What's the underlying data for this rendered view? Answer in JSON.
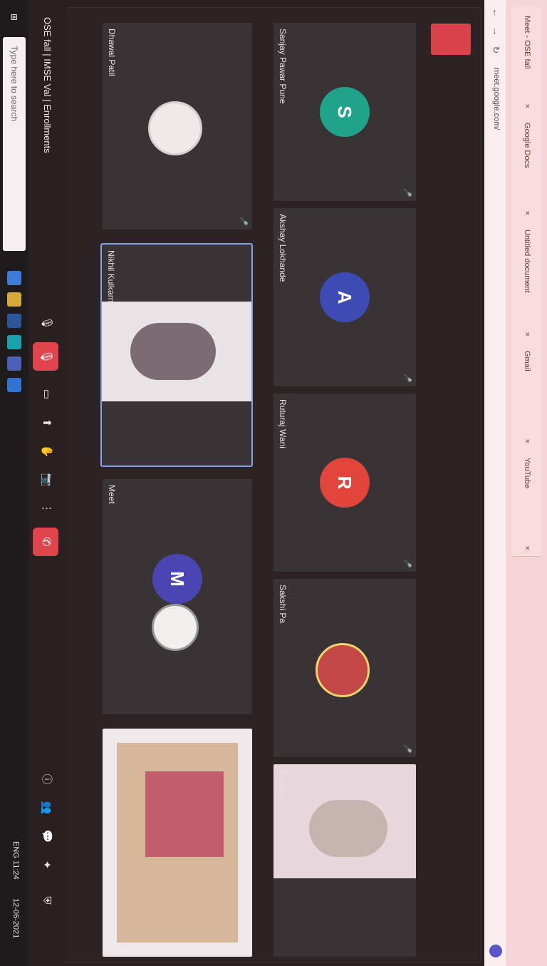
{
  "browser": {
    "tabs": [
      {
        "label": "Meet - OSE fall",
        "close": "×"
      },
      {
        "label": "Google Docs",
        "close": "×"
      },
      {
        "label": "Untitled document",
        "close": "×"
      },
      {
        "label": "Gmail",
        "close": "×"
      },
      {
        "label": "YouTube",
        "close": "×"
      }
    ],
    "url": "meet.google.com/",
    "nav_icons": [
      "back-arrow-icon",
      "forward-arrow-icon",
      "reload-icon"
    ],
    "nav_glyphs": [
      "←",
      "→",
      "↻"
    ]
  },
  "meeting": {
    "tiles": [
      {
        "name": "Sanjay Pawar Pune",
        "initial": "S",
        "color": "#1fa38a"
      },
      {
        "name": "Akshay Lokhande",
        "initial": "A",
        "color": "#3f4bb5"
      },
      {
        "name": "Ruturaj Wani",
        "initial": "R",
        "color": "#e0443b"
      },
      {
        "name": "Sakshi Pa",
        "initial": "",
        "color": "#c34747"
      },
      {
        "name": "Vaishali",
        "initial": "",
        "color": "#dcdbe8"
      },
      {
        "name": "Dhawal Patil",
        "initial": "",
        "color": "#efe9ea"
      },
      {
        "name": "Nikhil Kulkarni",
        "initial": "",
        "color": "#9b8f96"
      },
      {
        "name": "Meet",
        "initial": "M",
        "color": "#4a45b2"
      },
      {
        "name": "",
        "initial": "",
        "color": "#8a5b3e"
      }
    ],
    "mic_glyph": "🎤"
  },
  "toolbar": {
    "title": "OSE fall | IMSE Val | Enrollments",
    "buttons": [
      "mic-icon",
      "camera-icon",
      "caption-icon",
      "present-icon",
      "raise-hand-icon",
      "more-icon"
    ],
    "button_glyphs": [
      "🎙",
      "📷",
      "▭",
      "⬆",
      "✋",
      "⋮"
    ],
    "end_call_glyph": "✆",
    "right_buttons": [
      "info-icon",
      "people-icon",
      "chat-icon",
      "activities-icon"
    ],
    "right_glyphs": [
      "ⓘ",
      "👥",
      "💬",
      "✦"
    ]
  },
  "taskbar": {
    "search_placeholder": "Type here to search",
    "apps": [
      {
        "name": "chrome-icon",
        "color": "#3b7dd8"
      },
      {
        "name": "file-explorer-icon",
        "color": "#d6a93a"
      },
      {
        "name": "word-icon",
        "color": "#2b579a"
      },
      {
        "name": "edge-icon",
        "color": "#1ba1a9"
      },
      {
        "name": "store-icon",
        "color": "#4a5fb5"
      },
      {
        "name": "mail-icon",
        "color": "#2f74d0"
      }
    ],
    "tray_text": "ENG 11:24",
    "date_text": "12-06-2021"
  }
}
